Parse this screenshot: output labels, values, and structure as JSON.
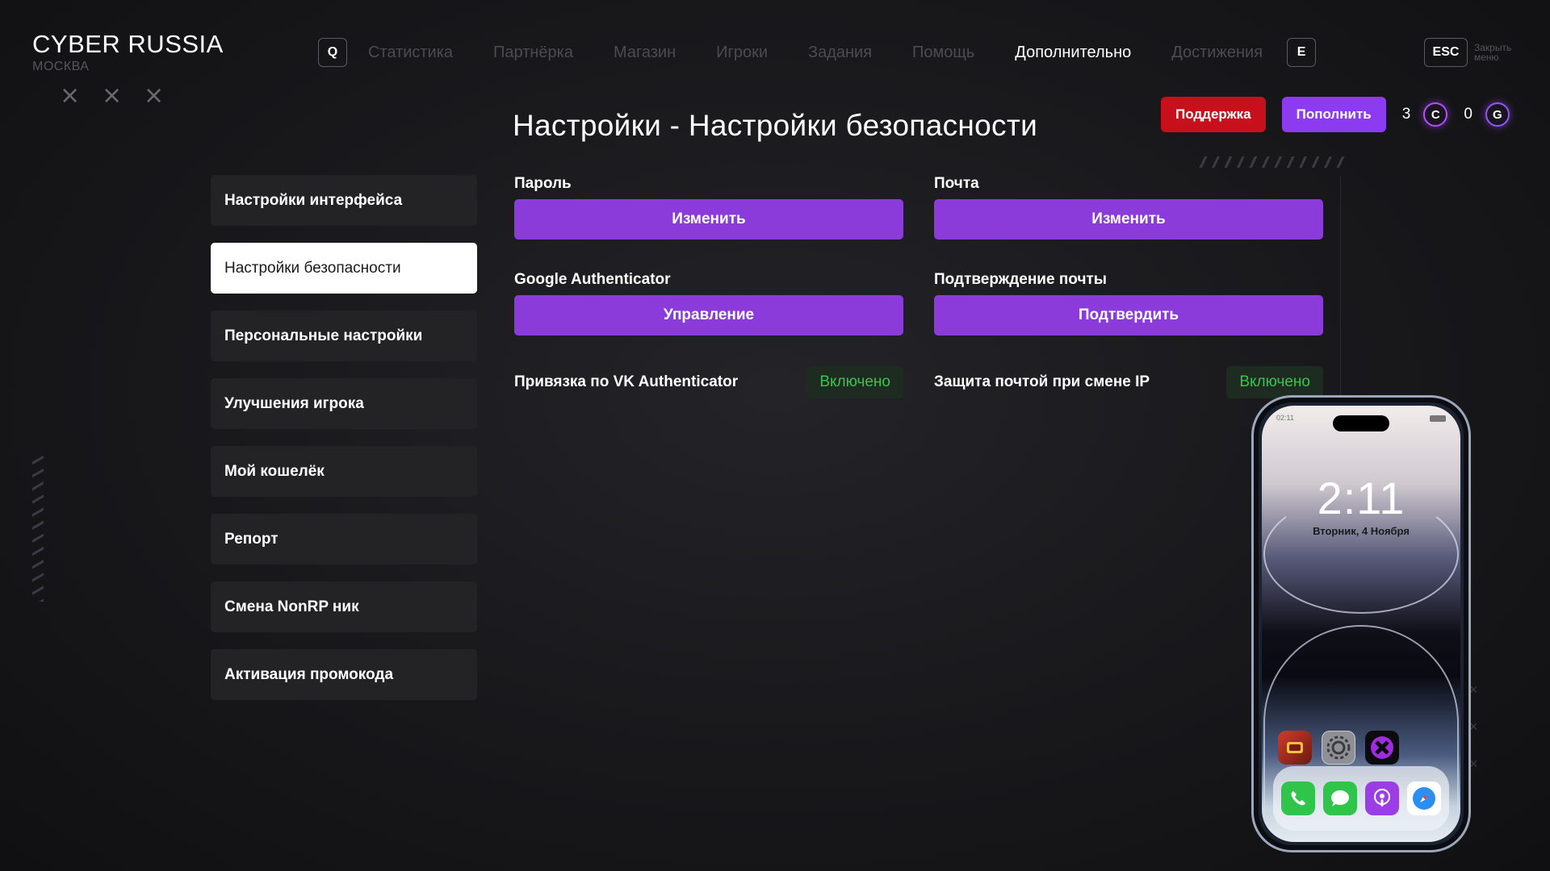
{
  "brand": {
    "title": "CYBER RUSSIA",
    "city": "МОСКВА"
  },
  "nav": {
    "key_left": "Q",
    "key_right": "E",
    "items": [
      {
        "label": "Статистика",
        "active": false
      },
      {
        "label": "Партнёрка",
        "active": false
      },
      {
        "label": "Магазин",
        "active": false
      },
      {
        "label": "Игроки",
        "active": false
      },
      {
        "label": "Задания",
        "active": false
      },
      {
        "label": "Помощь",
        "active": false
      },
      {
        "label": "Дополнительно",
        "active": true
      },
      {
        "label": "Достижения",
        "active": false
      }
    ],
    "esc_key": "ESC",
    "esc_label": "Закрыть меню"
  },
  "page_title": "Настройки - Настройки безопасности",
  "actions": {
    "support_label": "Поддержка",
    "topup_label": "Пополнить",
    "coins_c": {
      "value": "3",
      "symbol": "C"
    },
    "coins_g": {
      "value": "0",
      "symbol": "G"
    }
  },
  "sidebar": {
    "items": [
      {
        "label": "Настройки интерфейса",
        "active": false
      },
      {
        "label": "Настройки безопасности",
        "active": true
      },
      {
        "label": "Персональные настройки",
        "active": false
      },
      {
        "label": "Улучшения игрока",
        "active": false
      },
      {
        "label": "Мой кошелёк",
        "active": false
      },
      {
        "label": "Репорт",
        "active": false
      },
      {
        "label": "Смена NonRP ник",
        "active": false
      },
      {
        "label": "Активация промокода",
        "active": false
      }
    ]
  },
  "security": {
    "password": {
      "label": "Пароль",
      "button": "Изменить"
    },
    "email": {
      "label": "Почта",
      "button": "Изменить"
    },
    "google_auth": {
      "label": "Google Authenticator",
      "button": "Управление"
    },
    "email_confirm": {
      "label": "Подтверждение почты",
      "button": "Подтвердить"
    },
    "vk_auth": {
      "label": "Привязка по VK Authenticator",
      "status": "Включено"
    },
    "ip_protect": {
      "label": "Защита почтой при смене IP",
      "status": "Включено"
    }
  },
  "phone": {
    "status_time": "02:11",
    "clock": "2:11",
    "date": "Вторник, 4 Ноября"
  },
  "colors": {
    "accent_purple": "#8c3bdb",
    "support_red": "#c8101c",
    "status_green": "#3cc24e"
  }
}
